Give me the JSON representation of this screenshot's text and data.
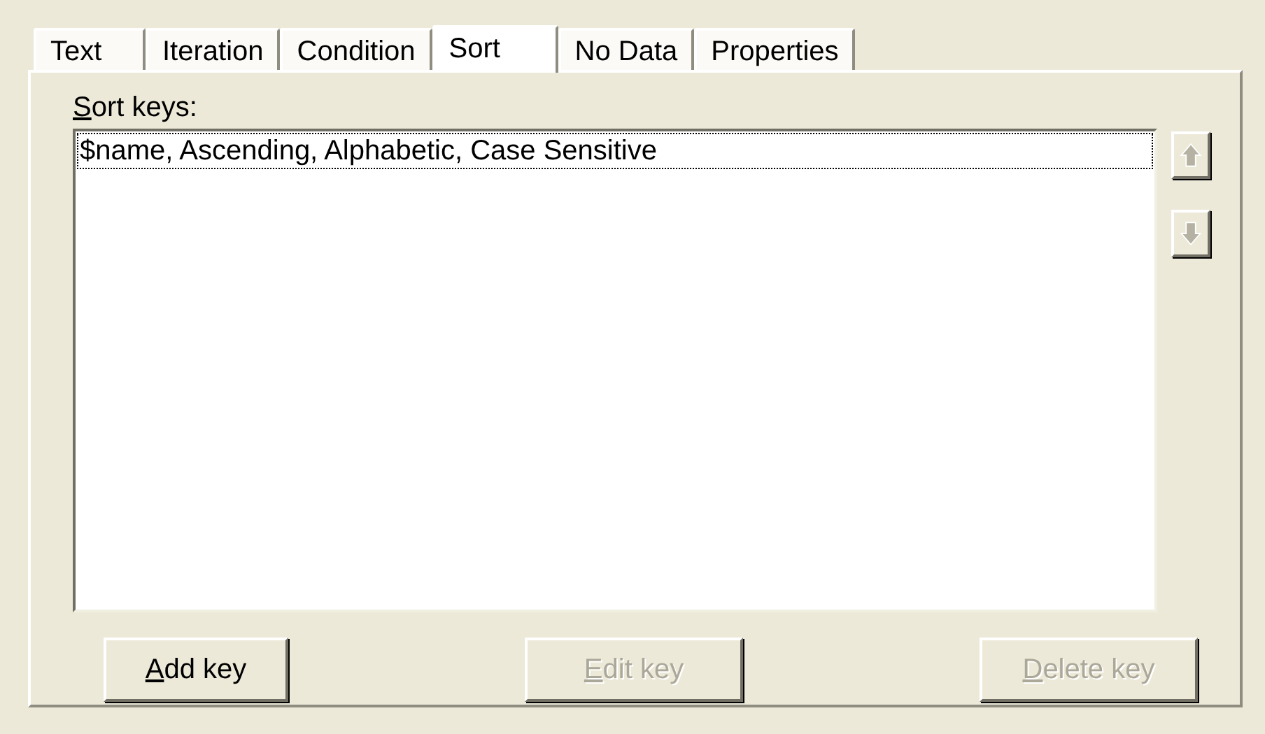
{
  "tabs": [
    {
      "label": "Text",
      "selected": false
    },
    {
      "label": "Iteration",
      "selected": false
    },
    {
      "label": "Condition",
      "selected": false
    },
    {
      "label": "Sort",
      "selected": true
    },
    {
      "label": "No Data",
      "selected": false
    },
    {
      "label": "Properties",
      "selected": false
    }
  ],
  "sort_keys": {
    "label": "Sort keys:",
    "mnemonic": true,
    "items": [
      {
        "text": "$name, Ascending, Alphabetic, Case Sensitive",
        "focused": true
      }
    ]
  },
  "move_buttons": [
    {
      "kind": "up",
      "disabled": true
    },
    {
      "kind": "down",
      "disabled": true
    }
  ],
  "buttons": [
    {
      "label": "Add key",
      "mnemonic": true,
      "disabled": false
    },
    {
      "label": "Edit key",
      "mnemonic": true,
      "disabled": true
    },
    {
      "label": "Delete key",
      "mnemonic": true,
      "disabled": true
    }
  ]
}
